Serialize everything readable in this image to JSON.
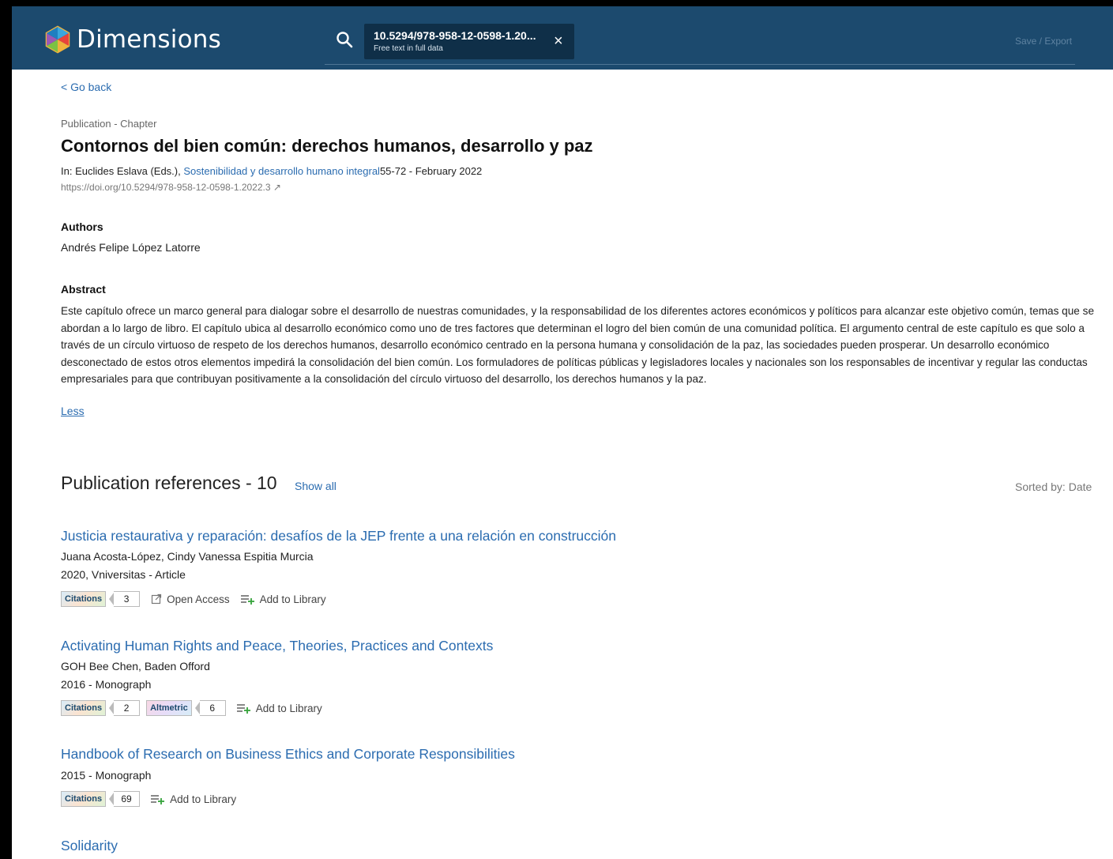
{
  "header": {
    "brand": "Dimensions",
    "search_value": "10.5294/978-958-12-0598-1.20...",
    "search_sub": "Free text in full data",
    "close_glyph": "×",
    "save_export": "Save / Export",
    "bg_color": "#1c4a6e"
  },
  "nav": {
    "go_back": "< Go back"
  },
  "publication": {
    "type": "Publication - Chapter",
    "title": "Contornos del bien común: derechos humanos, desarrollo y paz",
    "in_prefix": "In: Euclides Eslava (Eds.), ",
    "book_link": "Sostenibilidad y desarrollo humano integral",
    "pages_date": "55-72 - February 2022",
    "doi": "https://doi.org/10.5294/978-958-12-0598-1.2022.3 ↗",
    "authors_heading": "Authors",
    "authors": "Andrés Felipe López Latorre",
    "abstract_heading": "Abstract",
    "abstract": "Este capítulo ofrece un marco general para dialogar sobre el desarrollo de nuestras comunidades, y la responsabilidad de los diferentes actores económicos y políticos para alcanzar este objetivo común, temas que se abordan a lo largo de libro. El capítulo ubica al desarrollo económico como uno de tres factores que determinan el logro del bien común de una comunidad política. El argumento central de este capítulo es que solo a través de un círculo virtuoso de respeto de los derechos humanos, desarrollo económico centrado en la persona humana y consolidación de la paz, las sociedades pueden prosperar. Un desarrollo económico desconectado de estos otros elementos impedirá la consolidación del bien común. Los formuladores de políticas públicas y legisladores locales y nacionales son los responsables de incentivar y regular las conductas empresariales para que contribuyan positivamente a la consolidación del círculo virtuoso del desarrollo, los derechos humanos y la paz.",
    "less": "Less"
  },
  "references": {
    "heading": "Publication references - 10",
    "show_all": "Show all",
    "sorted": "Sorted by: Date",
    "citations_label": "Citations",
    "altmetric_label": "Altmetric",
    "open_access": "Open Access",
    "add_to_library": "Add to Library",
    "items": [
      {
        "title": "Justicia restaurativa y reparación: desafíos de la JEP frente a una relación en construcción",
        "authors": "Juana Acosta-López, Cindy Vanessa Espitia Murcia",
        "meta": "2020, Vniversitas - Article",
        "citations": "3"
      },
      {
        "title": "Activating Human Rights and Peace, Theories, Practices and Contexts",
        "authors": "GOH Bee Chen, Baden Offord",
        "meta": "2016 - Monograph",
        "citations": "2",
        "altmetric": "6"
      },
      {
        "title": "Handbook of Research on Business Ethics and Corporate Responsibilities",
        "meta": "2015 - Monograph",
        "citations": "69"
      },
      {
        "title": "Solidarity"
      }
    ]
  }
}
